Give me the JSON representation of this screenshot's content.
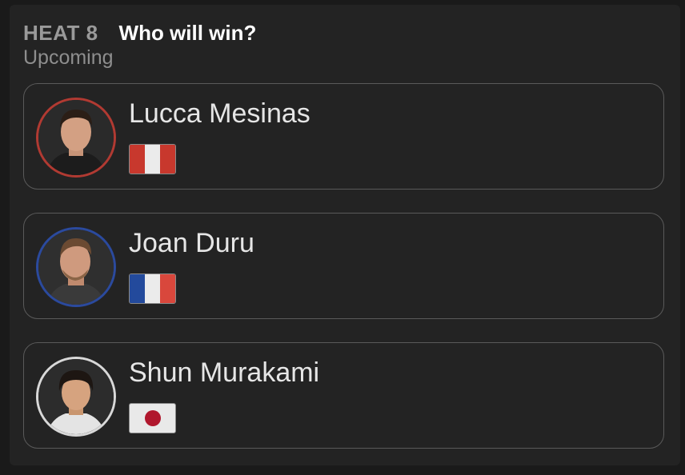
{
  "header": {
    "heat_label": "HEAT 8",
    "title": "Who will win?",
    "status": "Upcoming"
  },
  "riders": [
    {
      "name": "Lucca Mesinas",
      "country_flag": "peru-flag",
      "ring_color": "#b13a32",
      "flag_colors": [
        "#c8382d",
        "#ebebeb",
        "#c8382d"
      ]
    },
    {
      "name": "Joan Duru",
      "country_flag": "france-flag",
      "ring_color": "#2b4a9e",
      "flag_colors": [
        "#234a9c",
        "#ebebeb",
        "#d9473c"
      ]
    },
    {
      "name": "Shun Murakami",
      "country_flag": "japan-flag",
      "ring_color": "#d8d8d8",
      "flag_colors": [
        "#e9e9e9",
        "#b0172d"
      ]
    }
  ]
}
